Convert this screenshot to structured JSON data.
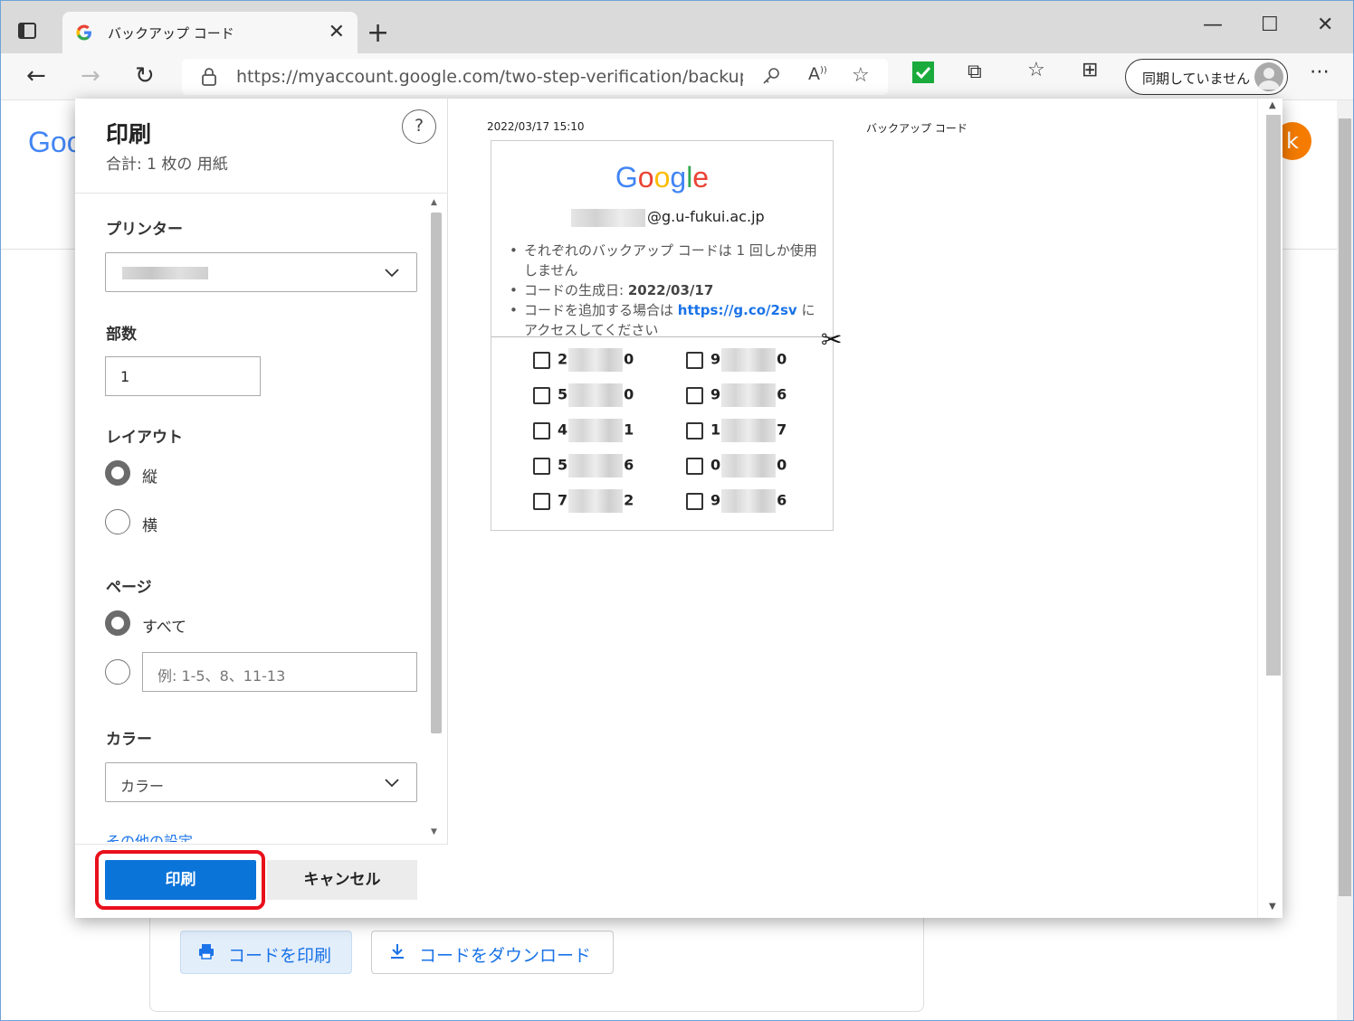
{
  "browser": {
    "tab_title": "バックアップ コード",
    "url": "https://myaccount.google.com/two-step-verification/backup-co...",
    "sync_label": "同期していません"
  },
  "page": {
    "logo_text": "Goo",
    "avatar_letter": "k",
    "print_codes_label": "コードを印刷",
    "download_codes_label": "コードをダウンロード"
  },
  "print_panel": {
    "title": "印刷",
    "summary": "合計: 1 枚の 用紙",
    "help": "?",
    "printer_label": "プリンター",
    "copies_label": "部数",
    "copies_value": "1",
    "layout_label": "レイアウト",
    "layout_options": [
      "縦",
      "横"
    ],
    "layout_selected": "縦",
    "pages_label": "ページ",
    "pages_all": "すべて",
    "pages_placeholder": "例: 1-5、8、11-13",
    "color_label": "カラー",
    "color_value": "カラー",
    "more_settings": "その他の設定",
    "print_button": "印刷",
    "cancel_button": "キャンセル"
  },
  "preview": {
    "timestamp": "2022/03/17 15:10",
    "doc_title": "バックアップ コード",
    "email_domain": "@g.u-fukui.ac.jp",
    "bullet1": "それぞれのバックアップ コードは 1 回しか使用しません",
    "bullet2_prefix": "コードの生成日: ",
    "bullet2_date": "2022/03/17",
    "bullet3_prefix": "コードを追加する場合は ",
    "bullet3_link": "https://g.co/2sv",
    "bullet3_suffix": " にアクセスしてください",
    "codes_left": [
      {
        "first": "2",
        "last": "0"
      },
      {
        "first": "5",
        "last": "0"
      },
      {
        "first": "4",
        "last": "1"
      },
      {
        "first": "5",
        "last": "6"
      },
      {
        "first": "7",
        "last": "2"
      }
    ],
    "codes_right": [
      {
        "first": "9",
        "last": "0"
      },
      {
        "first": "9",
        "last": "6"
      },
      {
        "first": "1",
        "last": "7"
      },
      {
        "first": "0",
        "last": "0"
      },
      {
        "first": "9",
        "last": "6"
      }
    ]
  }
}
